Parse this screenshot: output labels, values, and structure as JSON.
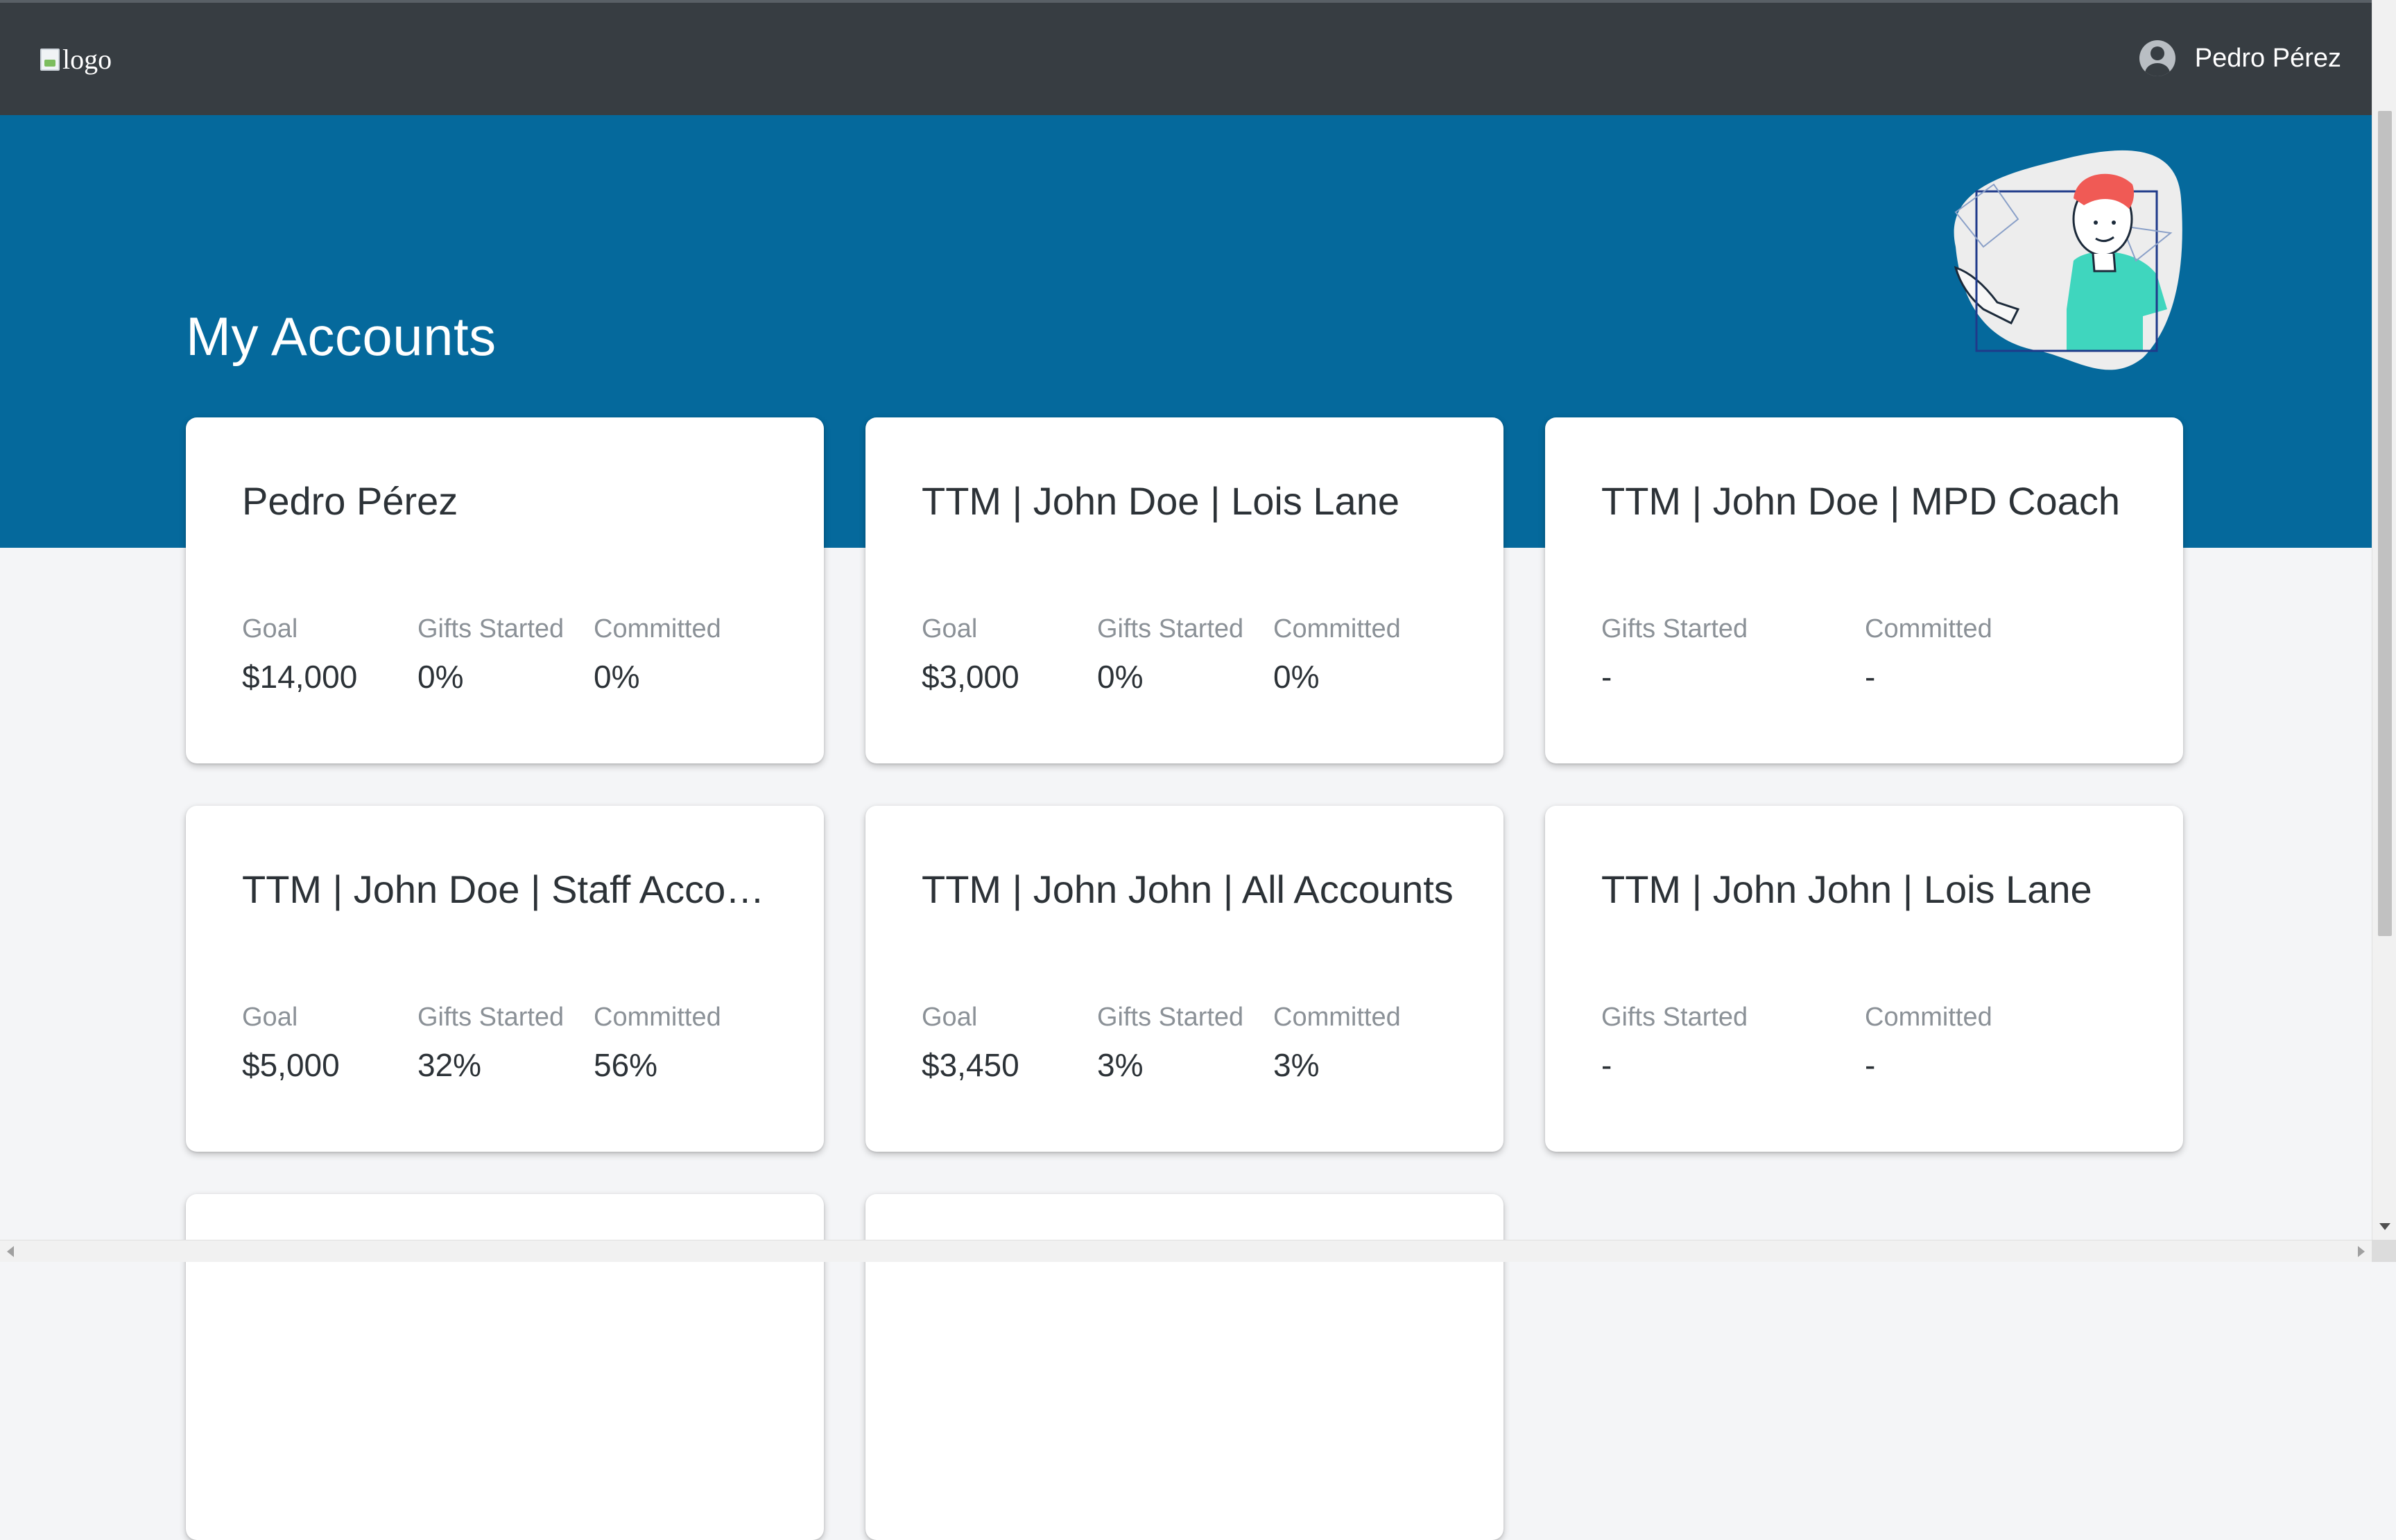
{
  "header": {
    "logo_alt": "logo",
    "user_name": "Pedro Pérez"
  },
  "hero": {
    "title": "My Accounts"
  },
  "accounts": [
    {
      "title": "Pedro Pérez",
      "goal_label": "Goal",
      "goal": "$14,000",
      "gifts_label": "Gifts Started",
      "gifts": "0%",
      "committed_label": "Committed",
      "committed": "0%"
    },
    {
      "title": "TTM | John Doe | Lois Lane",
      "goal_label": "Goal",
      "goal": "$3,000",
      "gifts_label": "Gifts Started",
      "gifts": "0%",
      "committed_label": "Committed",
      "committed": "0%"
    },
    {
      "title": "TTM | John Doe | MPD Coach",
      "gifts_label": "Gifts Started",
      "gifts": "-",
      "committed_label": "Committed",
      "committed": "-"
    },
    {
      "title": "TTM | John Doe | Staff Accou…",
      "goal_label": "Goal",
      "goal": "$5,000",
      "gifts_label": "Gifts Started",
      "gifts": "32%",
      "committed_label": "Committed",
      "committed": "56%"
    },
    {
      "title": "TTM | John John | All Accounts",
      "goal_label": "Goal",
      "goal": "$3,450",
      "gifts_label": "Gifts Started",
      "gifts": "3%",
      "committed_label": "Committed",
      "committed": "3%"
    },
    {
      "title": "TTM | John John | Lois Lane",
      "gifts_label": "Gifts Started",
      "gifts": "-",
      "committed_label": "Committed",
      "committed": "-"
    }
  ],
  "colors": {
    "topbar": "#373d42",
    "hero": "#05699c",
    "page_bg": "#f4f5f7",
    "card_bg": "#ffffff"
  },
  "icons": {
    "user": "account-circle-icon",
    "illustration": "person-presenting-illustration"
  }
}
